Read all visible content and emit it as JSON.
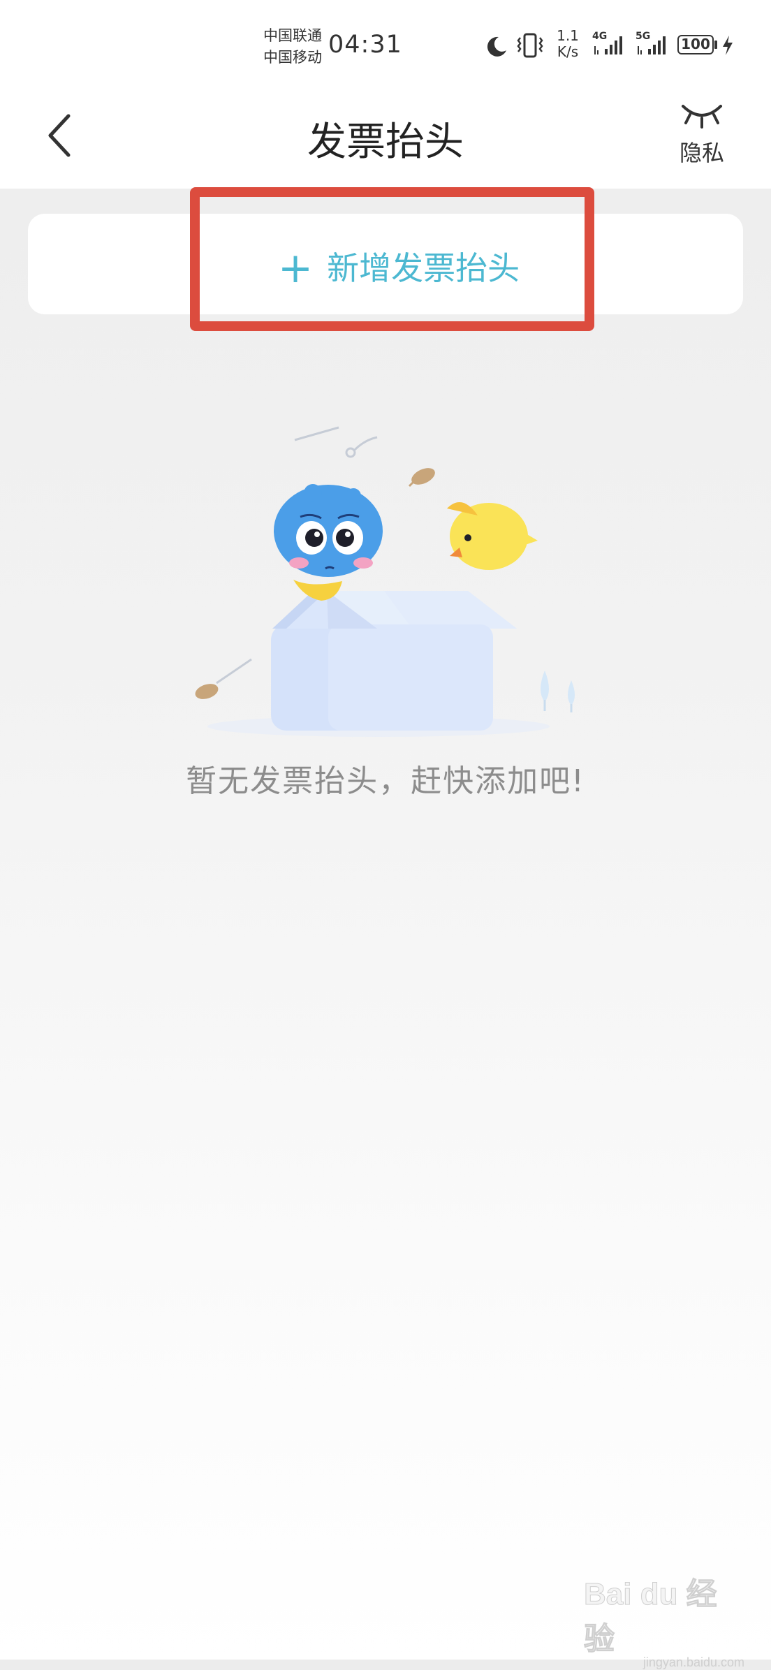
{
  "status_bar": {
    "carrier_1": "中国联通",
    "carrier_2": "中国移动",
    "time": "04:31",
    "speed_value": "1.1",
    "speed_unit": "K/s",
    "network_1": "4G",
    "network_2": "5G",
    "battery": "100",
    "icons": [
      "moon-icon",
      "vibrate-icon",
      "signal-icon",
      "battery-icon",
      "charging-icon"
    ]
  },
  "header": {
    "title": "发票抬头",
    "privacy_label": "隐私",
    "back_icon": "chevron-left-icon",
    "privacy_icon": "closed-eye-icon"
  },
  "add_card": {
    "plus_symbol": "+",
    "label": "新增发票抬头",
    "accent_color": "#4cb8d1"
  },
  "annotation": {
    "highlight_color": "#dc4c3e"
  },
  "empty_state": {
    "message": "暂无发票抬头，赶快添加吧!",
    "illustration": "mascot-in-box-illustration"
  },
  "watermark": {
    "main": "Bai du 经验",
    "sub": "jingyan.baidu.com"
  }
}
